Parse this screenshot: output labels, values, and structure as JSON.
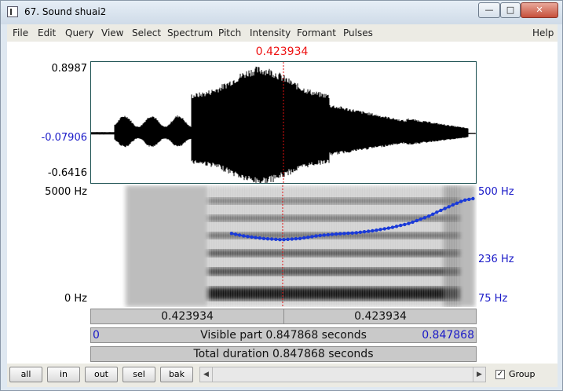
{
  "window": {
    "title": "67. Sound shuai2",
    "minimize": "—",
    "maximize": "□",
    "close": "✕"
  },
  "menu": [
    "File",
    "Edit",
    "Query",
    "View",
    "Select",
    "Spectrum",
    "Pitch",
    "Intensity",
    "Formant",
    "Pulses",
    "Help"
  ],
  "cursor_time": "0.423934",
  "waveform": {
    "max_label": "0.8987",
    "zero_label": "-0.07906",
    "min_label": "-0.6416"
  },
  "spectrogram": {
    "top_freq": "5000 Hz",
    "bottom_freq": "0 Hz",
    "pitch_top": "500 Hz",
    "pitch_mid": "236 Hz",
    "pitch_bottom": "75 Hz"
  },
  "bars": {
    "left_part": "0.423934",
    "right_part": "0.423934",
    "visible_start": "0",
    "visible_label": "Visible part 0.847868 seconds",
    "visible_end": "0.847868",
    "total_label": "Total duration 0.847868 seconds"
  },
  "toolbar": {
    "buttons": [
      "all",
      "in",
      "out",
      "sel",
      "bak"
    ],
    "group_label": "Group",
    "group_checked": "✓",
    "scroll_left": "◀",
    "scroll_right": "▶"
  },
  "colors": {
    "cursor": "#e11111",
    "pitch": "#1a3ad8",
    "value_blue": "#1a1ac8"
  },
  "chart_data": {
    "type": "line",
    "x_range": [
      0,
      0.847868
    ],
    "cursor": 0.423934,
    "pitch_range_hz": [
      75,
      500
    ],
    "pitch": {
      "x": [
        0.31,
        0.34,
        0.38,
        0.42,
        0.46,
        0.5,
        0.54,
        0.58,
        0.62,
        0.66,
        0.7,
        0.74,
        0.78,
        0.82,
        0.84
      ],
      "y": [
        236,
        226,
        218,
        214,
        218,
        228,
        234,
        238,
        246,
        258,
        276,
        306,
        350,
        396,
        406
      ]
    }
  }
}
